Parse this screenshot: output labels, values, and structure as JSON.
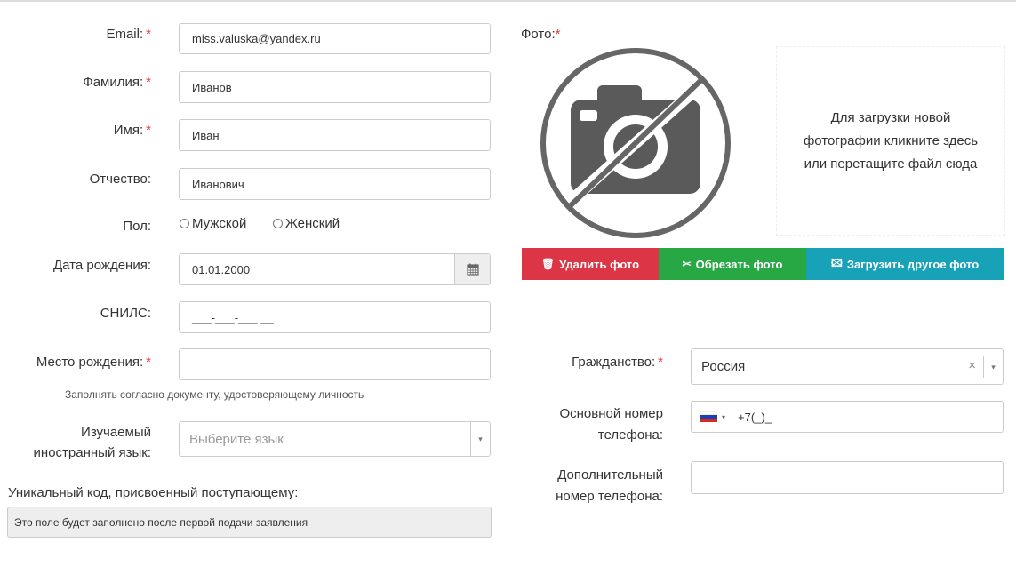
{
  "form": {
    "email": {
      "label": "Email:",
      "value": "miss.valuska@yandex.ru",
      "required": "*"
    },
    "surname": {
      "label": "Фамилия:",
      "value": "Иванов",
      "required": "*"
    },
    "name": {
      "label": "Имя:",
      "value": "Иван",
      "required": "*"
    },
    "patronymic": {
      "label": "Отчество:",
      "value": "Иванович"
    },
    "gender": {
      "label": "Пол:",
      "options": [
        "Мужской",
        "Женский"
      ]
    },
    "birthdate": {
      "label": "Дата рождения:",
      "value": "01.01.2000"
    },
    "snils": {
      "label": "СНИЛС:",
      "value": "___-___-___ __"
    },
    "birthplace": {
      "label": "Место рождения:",
      "value": "",
      "required": "*",
      "hint": "Заполнять согласно документу, удостоверяющему личность"
    },
    "language": {
      "label_line1": "Изучаемый",
      "label_line2": "иностранный язык:",
      "placeholder": "Выберите язык",
      "caret": "▾"
    },
    "unique_code": {
      "label": "Уникальный код, присвоенный поступающему:",
      "value": "Это поле будет заполнено после первой подачи заявления"
    }
  },
  "photo": {
    "label": "Фото:",
    "required": "*",
    "dropzone_line1": "Для загрузки новой",
    "dropzone_line2": "фотографии кликните здесь",
    "dropzone_line3": "или перетащите файл сюда",
    "buttons": {
      "delete": {
        "icon": "🗑",
        "label": "Удалить фото",
        "color": "#dc3545"
      },
      "crop": {
        "icon": "✂",
        "label": "Обрезать фото",
        "color": "#28a745"
      },
      "upload": {
        "icon": "🖾",
        "label": "Загрузить другое фото",
        "color": "#17a2b8"
      }
    }
  },
  "citizenship": {
    "label": "Гражданство:",
    "required": "*",
    "value": "Россия",
    "clear": "×",
    "caret": "▾"
  },
  "phone_main": {
    "label_line1": "Основной номер",
    "label_line2": "телефона:",
    "value": "+7(_)_",
    "flag_caret": "▾"
  },
  "phone_extra": {
    "label_line1": "Дополнительный",
    "label_line2": "номер телефона:",
    "value": ""
  }
}
